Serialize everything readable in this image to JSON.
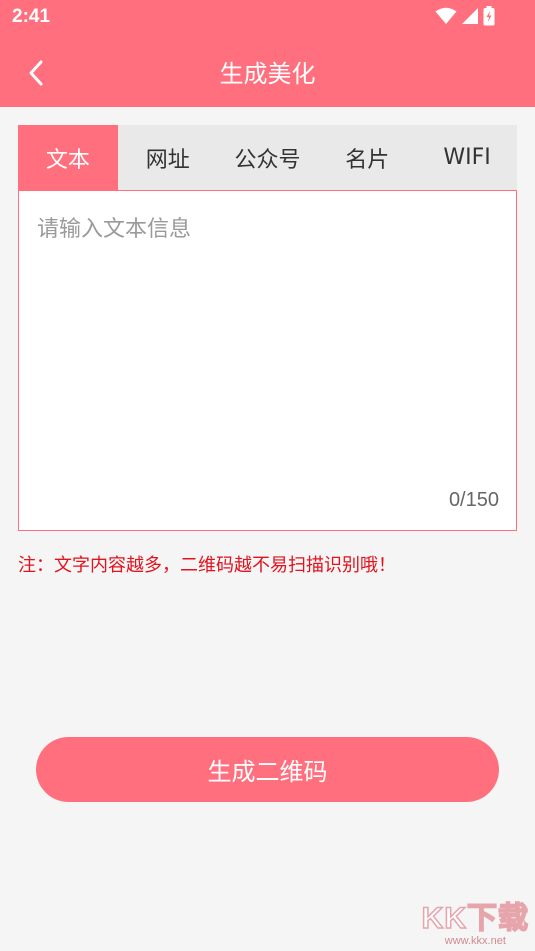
{
  "status_bar": {
    "time": "2:41",
    "icons": [
      "wifi-icon",
      "signal-icon",
      "battery-icon"
    ]
  },
  "header": {
    "back_icon": "chevron-left-icon",
    "title": "生成美化"
  },
  "tabs": [
    {
      "label": "文本",
      "active": true
    },
    {
      "label": "网址",
      "active": false
    },
    {
      "label": "公众号",
      "active": false
    },
    {
      "label": "名片",
      "active": false
    },
    {
      "label": "WIFI",
      "active": false
    }
  ],
  "text_input": {
    "value": "",
    "placeholder": "请输入文本信息",
    "counter": "0/150"
  },
  "note": "注：文字内容越多，二维码越不易扫描识别哦！",
  "generate_button": "生成二维码",
  "watermark": {
    "logo": "KK下载",
    "url": "www.kkx.net"
  },
  "colors": {
    "accent": "#ff6f7d",
    "warning_text": "#e0131e",
    "background": "#f5f5f5"
  }
}
